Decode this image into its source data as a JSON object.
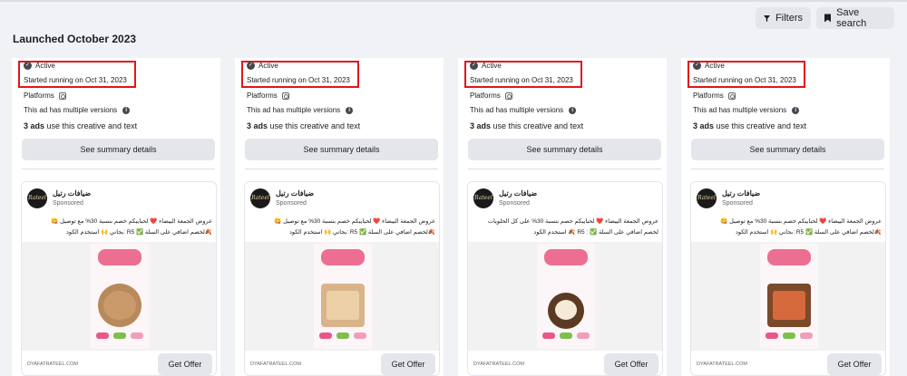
{
  "header": {
    "filters_label": "Filters",
    "save_search_label": "Save search",
    "section_title": "Launched October 2023"
  },
  "cards": [
    {
      "status": "Active",
      "started": "Started running on Oct 31, 2023",
      "platforms_label": "Platforms",
      "multiple_versions": "This ad has multiple versions",
      "ads_count": "3 ads",
      "ads_suffix": " use this creative and text",
      "summary_label": "See summary details",
      "advertiser": "ضيافات رتيل",
      "sponsored": "Sponsored",
      "ad_text_1": "عروض الجمعة البيضاء ❤️ لحبايبكم خصم بنسبة 30% مع توصيل 😋",
      "ad_text_2": "🍂لخصم اضافي على السلة ✅ R5 :بجاني 🙌 استخدم الكود",
      "domain": "DYAFATRATEEL.COM",
      "cta": "Get Offer"
    },
    {
      "status": "Active",
      "started": "Started running on Oct 31, 2023",
      "platforms_label": "Platforms",
      "multiple_versions": "This ad has multiple versions",
      "ads_count": "3 ads",
      "ads_suffix": " use this creative and text",
      "summary_label": "See summary details",
      "advertiser": "ضيافات رتيل",
      "sponsored": "Sponsored",
      "ad_text_1": "عروض الجمعة البيضاء ❤️ لحبايبكم خصم بنسبة 30% مع توصيل 😋",
      "ad_text_2": "🍂لخصم اضافي على السلة ✅ R5 :بجاني 🙌 استخدم الكود",
      "domain": "DYAFATRATEEL.COM",
      "cta": "Get Offer"
    },
    {
      "status": "Active",
      "started": "Started running on Oct 31, 2023",
      "platforms_label": "Platforms",
      "multiple_versions": "This ad has multiple versions",
      "ads_count": "3 ads",
      "ads_suffix": " use this creative and text",
      "summary_label": "See summary details",
      "advertiser": "ضيافات رتيل",
      "sponsored": "Sponsored",
      "ad_text_1": "عروض الجمعة البيضاء ❤️ لحبايبكم خصم بنسبة 30% على كل الحلويات",
      "ad_text_2": "لخصم اضافي على السلة ✅ : R5 🍂 استخدم الكود",
      "domain": "DYAFATRATEEL.COM",
      "cta": "Get Offer"
    },
    {
      "status": "Active",
      "started": "Started running on Oct 31, 2023",
      "platforms_label": "Platforms",
      "multiple_versions": "This ad has multiple versions",
      "ads_count": "3 ads",
      "ads_suffix": " use this creative and text",
      "summary_label": "See summary details",
      "advertiser": "ضيافات رتيل",
      "sponsored": "Sponsored",
      "ad_text_1": "عروض الجمعة البيضاء ❤️ لحبايبكم خصم بنسبة 30% مع توصيل 😋",
      "ad_text_2": "🍂لخصم اضافي على السلة ✅ R5 :بجاني 🙌 استخدم الكود",
      "domain": "DYAFATRATEEL.COM",
      "cta": "Get Offer"
    }
  ],
  "colors": {
    "highlight_border": "#e0161b",
    "button_bg": "#e4e6eb",
    "page_bg": "#f0f2f5"
  },
  "icons": [
    "filter-icon",
    "bookmark-icon",
    "check-circle-icon",
    "instagram-icon",
    "info-icon"
  ]
}
